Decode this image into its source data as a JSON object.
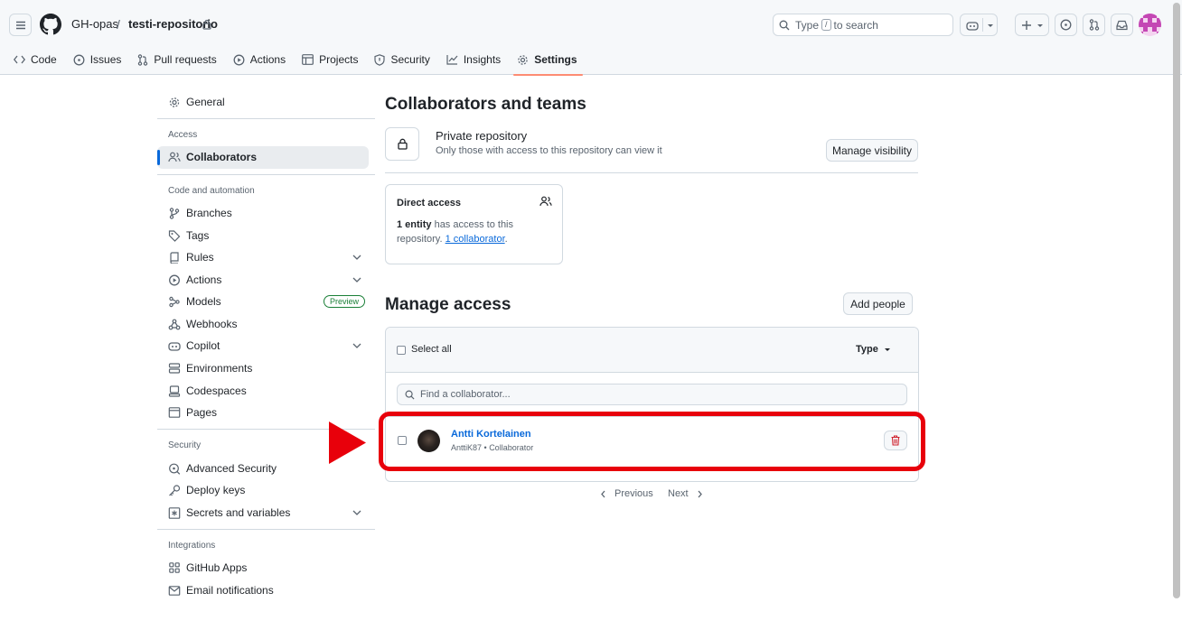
{
  "header": {
    "owner": "GH-opas",
    "separator": "/",
    "repo": "testi-repositorio",
    "search": {
      "prefix": "Type",
      "key": "/",
      "suffix": "to search"
    }
  },
  "tabs": [
    {
      "label": "Code",
      "icon": "code-icon"
    },
    {
      "label": "Issues",
      "icon": "issue-opened-icon"
    },
    {
      "label": "Pull requests",
      "icon": "git-pull-request-icon"
    },
    {
      "label": "Actions",
      "icon": "play-icon"
    },
    {
      "label": "Projects",
      "icon": "table-icon"
    },
    {
      "label": "Security",
      "icon": "shield-icon"
    },
    {
      "label": "Insights",
      "icon": "graph-icon"
    },
    {
      "label": "Settings",
      "icon": "gear-icon",
      "active": true
    }
  ],
  "sidebar": {
    "general": "General",
    "access_heading": "Access",
    "collaborators": "Collaborators",
    "code_heading": "Code and automation",
    "code_items": [
      "Branches",
      "Tags",
      "Rules",
      "Actions",
      "Models",
      "Webhooks",
      "Copilot",
      "Environments",
      "Codespaces",
      "Pages"
    ],
    "preview_badge": "Preview",
    "security_heading": "Security",
    "security_items": [
      "Advanced Security",
      "Deploy keys",
      "Secrets and variables"
    ],
    "integrations_heading": "Integrations",
    "integrations_items": [
      "GitHub Apps",
      "Email notifications"
    ]
  },
  "main": {
    "title": "Collaborators and teams",
    "private_title": "Private repository",
    "private_desc": "Only those with access to this repository can view it",
    "manage_visibility": "Manage visibility",
    "direct_access": {
      "title": "Direct access",
      "count": "1 entity",
      "text1": " has access to this",
      "text2": "repository. ",
      "link": "1 collaborator",
      "end": "."
    },
    "manage_access_title": "Manage access",
    "add_people": "Add people",
    "select_all": "Select all",
    "type_label": "Type",
    "find_placeholder": "Find a collaborator...",
    "collaborator": {
      "name": "Antti Kortelainen",
      "username": "AnttiK87",
      "role": "Collaborator",
      "sep": " • "
    },
    "pagination": {
      "previous": "Previous",
      "next": "Next"
    }
  },
  "colors": {
    "accent": "#0969da",
    "highlight": "#e8000b",
    "danger": "#cf222e"
  }
}
